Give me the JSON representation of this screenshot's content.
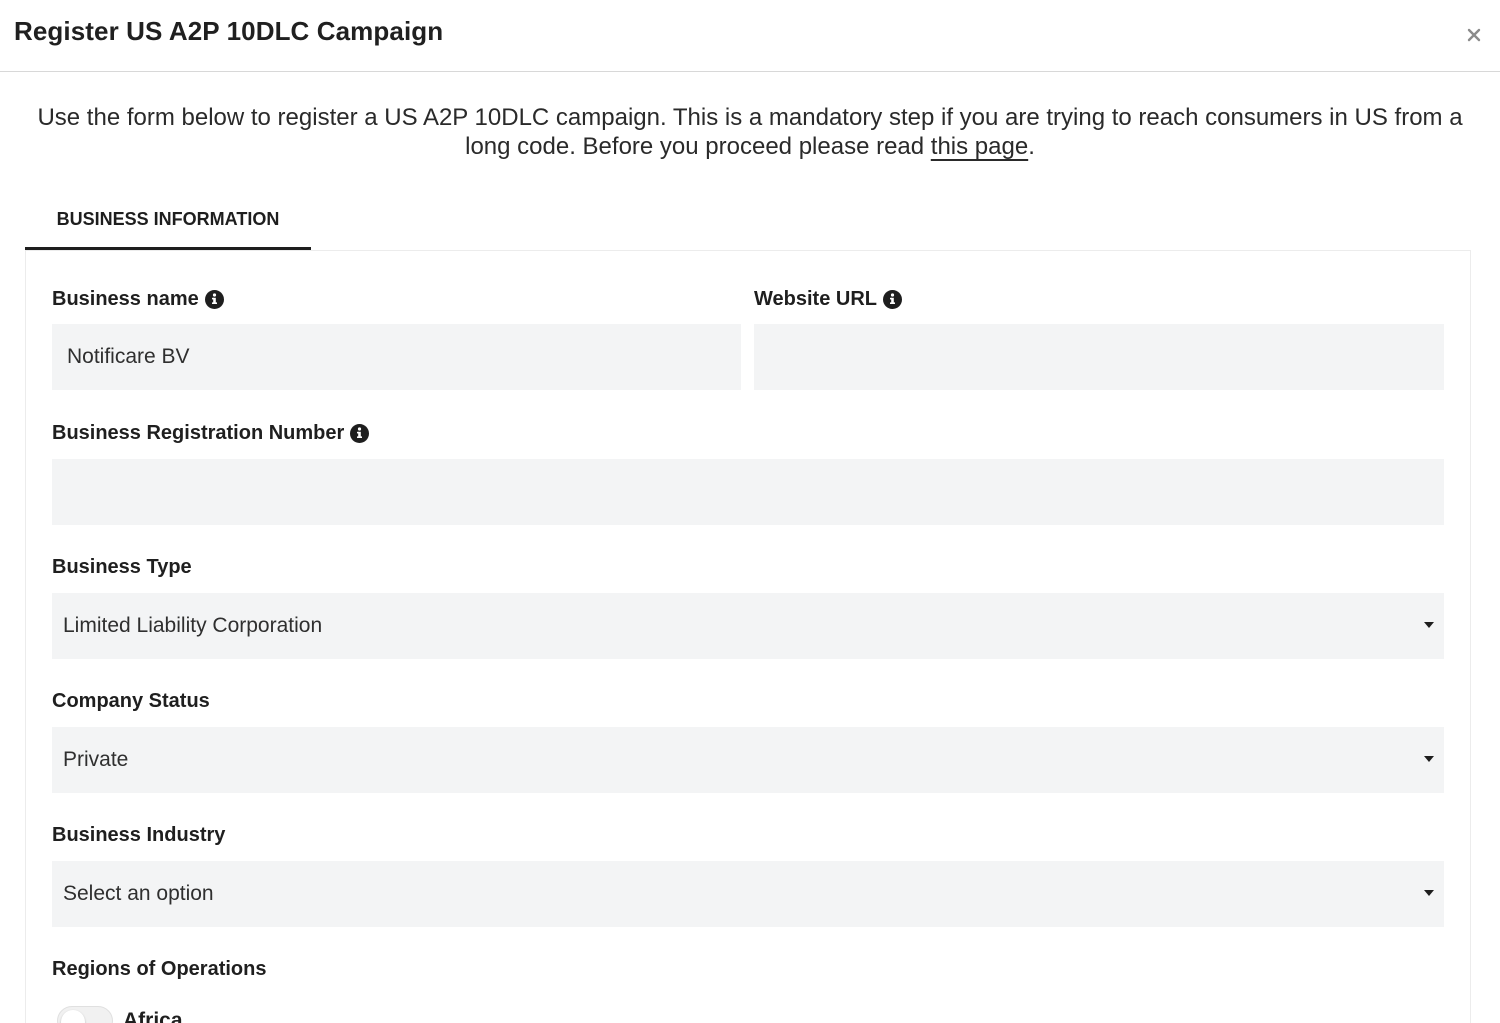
{
  "modal": {
    "title": "Register US A2P 10DLC Campaign",
    "close_icon": "close-icon"
  },
  "intro": {
    "text": "Use the form below to register a US A2P 10DLC campaign. This is a mandatory step if you are trying to reach consumers in US from a long code. Before you proceed please read ",
    "link_text": "this page",
    "trailing": "."
  },
  "tabs": [
    {
      "label": "BUSINESS INFORMATION",
      "active": true
    }
  ],
  "form": {
    "business_name": {
      "label": "Business name",
      "value": "Notificare BV",
      "icon": "info-icon"
    },
    "website_url": {
      "label": "Website URL",
      "value": "",
      "icon": "info-icon"
    },
    "registration_number": {
      "label": "Business Registration Number",
      "value": "",
      "icon": "info-icon"
    },
    "business_type": {
      "label": "Business Type",
      "value": "Limited Liability Corporation",
      "icon": "caret-down-icon"
    },
    "company_status": {
      "label": "Company Status",
      "value": "Private",
      "icon": "caret-down-icon"
    },
    "business_industry": {
      "label": "Business Industry",
      "value": "Select an option",
      "icon": "caret-down-icon"
    },
    "regions": {
      "label": "Regions of Operations",
      "options": [
        {
          "label": "Africa",
          "enabled": false
        }
      ]
    }
  },
  "colors": {
    "field_background": "#f3f4f5",
    "text": "#232323",
    "tab_indicator": "#1e1e1e",
    "divider": "#d8d8d8"
  }
}
